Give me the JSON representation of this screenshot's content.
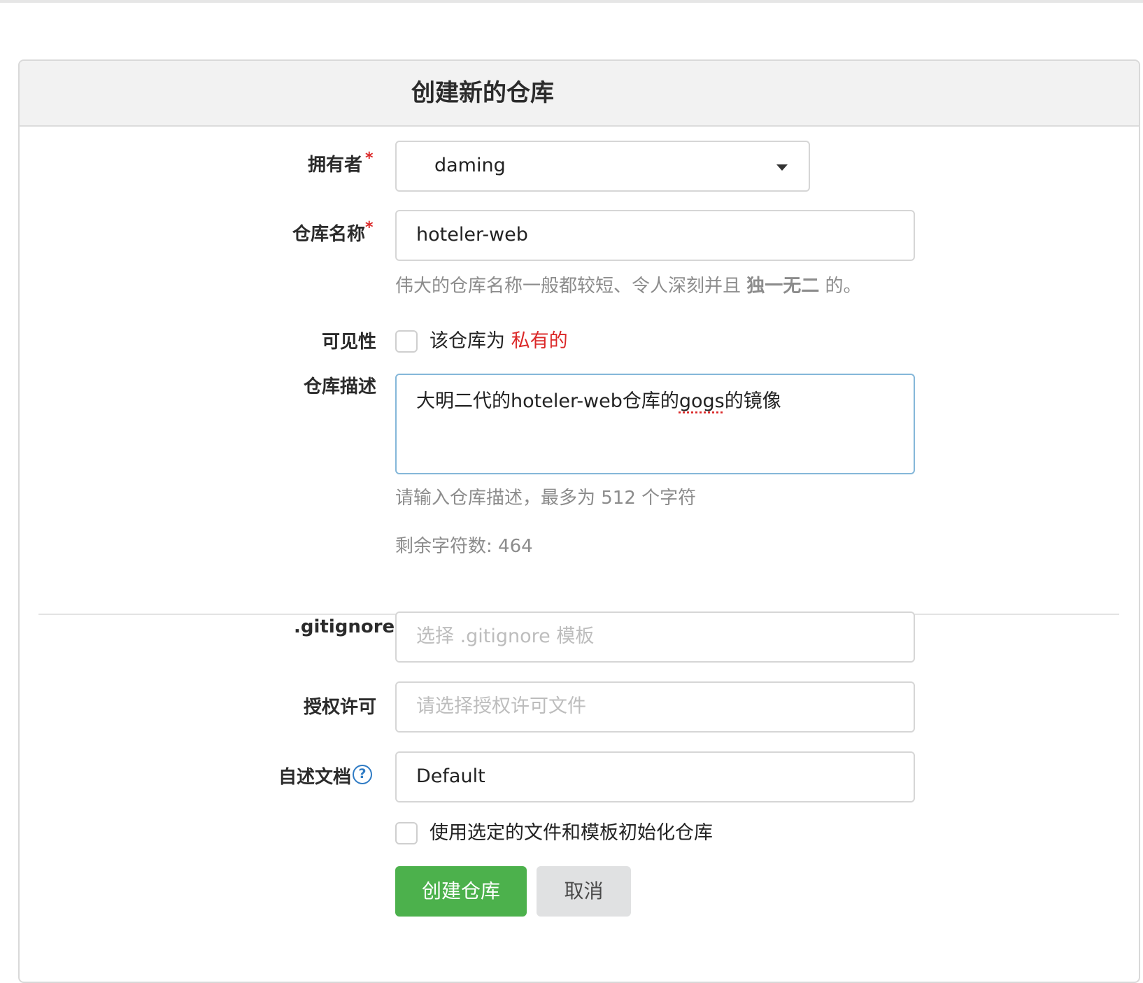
{
  "form": {
    "title": "创建新的仓库",
    "owner": {
      "label": "拥有者",
      "required_mark": "*",
      "value": "daming"
    },
    "repo_name": {
      "label": "仓库名称",
      "required_mark": "*",
      "value": "hoteler-web",
      "help_prefix": "伟大的仓库名称一般都较短、令人深刻并且 ",
      "help_bold": "独一无二",
      "help_suffix": " 的。"
    },
    "visibility": {
      "label": "可见性",
      "checkbox_prefix": "该仓库为 ",
      "checkbox_highlight": "私有的",
      "checked": false
    },
    "description": {
      "label": "仓库描述",
      "value_part1": "大明二代的hoteler-web仓库的",
      "value_misspelled": "gogs",
      "value_part2": "的镜像",
      "help": "请输入仓库描述，最多为 512 个字符",
      "remaining": "剩余字符数: 464"
    },
    "gitignore": {
      "label": ".gitignore",
      "placeholder": "选择 .gitignore 模板"
    },
    "license": {
      "label": "授权许可",
      "placeholder": "请选择授权许可文件"
    },
    "readme": {
      "label": "自述文档",
      "help_icon": "?",
      "value": "Default"
    },
    "auto_init": {
      "label": "使用选定的文件和模板初始化仓库",
      "checked": false
    },
    "buttons": {
      "create": "创建仓库",
      "cancel": "取消"
    }
  },
  "colors": {
    "primary_button": "#4cb14c",
    "required": "#db2828",
    "private_text": "#db2828",
    "help_icon": "#2f7bc4"
  }
}
